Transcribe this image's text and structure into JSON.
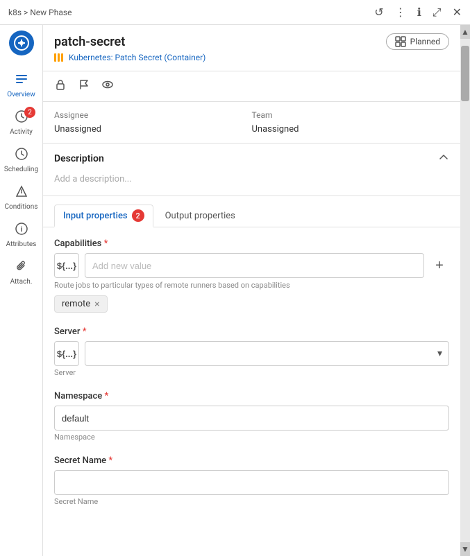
{
  "titlebar": {
    "breadcrumb": "k8s > New Phase",
    "refresh_icon": "↺",
    "more_icon": "⋮",
    "info_icon": "ℹ",
    "expand_icon": "⤢",
    "close_icon": "✕"
  },
  "sidebar": {
    "logo_icon": "⚙",
    "items": [
      {
        "id": "overview",
        "label": "Overview",
        "icon": "≡",
        "badge": null,
        "active": true
      },
      {
        "id": "activity",
        "label": "Activity",
        "icon": "◷",
        "badge": "2",
        "active": false
      },
      {
        "id": "scheduling",
        "label": "Scheduling",
        "icon": "◷",
        "badge": null,
        "active": false
      },
      {
        "id": "conditions",
        "label": "Conditions",
        "icon": "◇",
        "badge": null,
        "active": false
      },
      {
        "id": "attributes",
        "label": "Attributes",
        "icon": "ℹ",
        "badge": null,
        "active": false
      },
      {
        "id": "attach",
        "label": "Attach.",
        "icon": "🔗",
        "badge": null,
        "active": false
      }
    ]
  },
  "header": {
    "title": "patch-secret",
    "subtitle": "Kubernetes: Patch Secret (Container)",
    "status": "Planned",
    "status_icon": "▦"
  },
  "action_icons": {
    "lock_icon": "🔒",
    "flag_icon": "🚩",
    "eye_icon": "👁"
  },
  "assignee": {
    "label": "Assignee",
    "value": "Unassigned"
  },
  "team": {
    "label": "Team",
    "value": "Unassigned"
  },
  "description": {
    "title": "Description",
    "placeholder": "Add a description..."
  },
  "tabs": [
    {
      "id": "input",
      "label": "Input properties",
      "badge": "2",
      "active": true
    },
    {
      "id": "output",
      "label": "Output properties",
      "badge": null,
      "active": false
    }
  ],
  "form": {
    "capabilities": {
      "label": "Capabilities",
      "required": true,
      "var_label": "${...}",
      "placeholder": "Add new value",
      "add_icon": "+",
      "help_text": "Route jobs to particular types of remote runners based on capabilities",
      "tags": [
        {
          "value": "remote",
          "remove_icon": "×"
        }
      ]
    },
    "server": {
      "label": "Server",
      "required": true,
      "var_label": "${...}",
      "hint": "Server",
      "options": []
    },
    "namespace": {
      "label": "Namespace",
      "required": true,
      "value": "default",
      "hint": "Namespace"
    },
    "secret_name": {
      "label": "Secret Name",
      "required": true,
      "value": "",
      "hint": "Secret Name",
      "placeholder": ""
    }
  }
}
